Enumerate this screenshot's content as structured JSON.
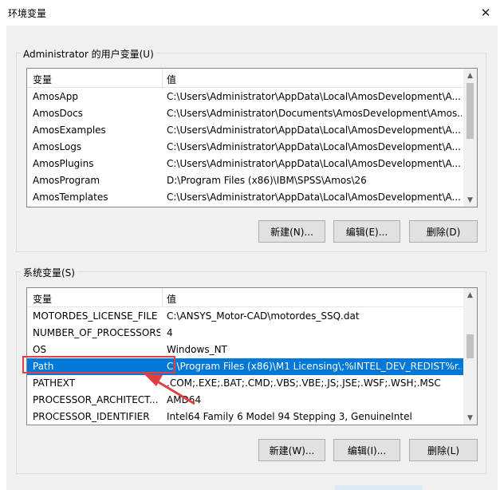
{
  "window": {
    "title": "环境变量",
    "close_icon": "close-icon"
  },
  "user_vars": {
    "group_label": "Administrator 的用户变量(U)",
    "columns": [
      "变量",
      "值"
    ],
    "rows": [
      {
        "name": "AmosApp",
        "value": "C:\\Users\\Administrator\\AppData\\Local\\AmosDevelopment\\A..."
      },
      {
        "name": "AmosDocs",
        "value": "C:\\Users\\Administrator\\Documents\\AmosDevelopment\\Amos..."
      },
      {
        "name": "AmosExamples",
        "value": "C:\\Users\\Administrator\\AppData\\Local\\AmosDevelopment\\A..."
      },
      {
        "name": "AmosLogs",
        "value": "C:\\Users\\Administrator\\AppData\\Local\\AmosDevelopment\\A..."
      },
      {
        "name": "AmosPlugins",
        "value": "C:\\Users\\Administrator\\AppData\\Local\\AmosDevelopment\\A..."
      },
      {
        "name": "AmosProgram",
        "value": "D:\\Program Files (x86)\\IBM\\SPSS\\Amos\\26"
      },
      {
        "name": "AmosTemplates",
        "value": "C:\\Users\\Administrator\\AppData\\Local\\AmosDevelopment\\A..."
      }
    ],
    "buttons": {
      "new": "新建(N)...",
      "edit": "编辑(E)...",
      "delete": "删除(D)"
    }
  },
  "system_vars": {
    "group_label": "系统变量(S)",
    "columns": [
      "变量",
      "值"
    ],
    "rows": [
      {
        "name": "MOTORDES_LICENSE_FILE",
        "value": "C:\\ANSYS_Motor-CAD\\motordes_SSQ.dat"
      },
      {
        "name": "NUMBER_OF_PROCESSORS",
        "value": "4"
      },
      {
        "name": "OS",
        "value": "Windows_NT"
      },
      {
        "name": "Path",
        "value": "C:\\Program Files (x86)\\M1 Licensing\\;%INTEL_DEV_REDIST%r...",
        "selected": true
      },
      {
        "name": "PATHEXT",
        "value": ".COM;.EXE;.BAT;.CMD;.VBS;.VBE;.JS;.JSE;.WSF;.WSH;.MSC"
      },
      {
        "name": "PROCESSOR_ARCHITECT...",
        "value": "AMD64"
      },
      {
        "name": "PROCESSOR_IDENTIFIER",
        "value": "Intel64 Family 6 Model 94 Stepping 3, GenuineIntel"
      }
    ],
    "buttons": {
      "new": "新建(W)...",
      "edit": "编辑(I)...",
      "delete": "删除(L)"
    }
  },
  "colors": {
    "selection": "#0078d7",
    "annotation": "#e04040"
  }
}
